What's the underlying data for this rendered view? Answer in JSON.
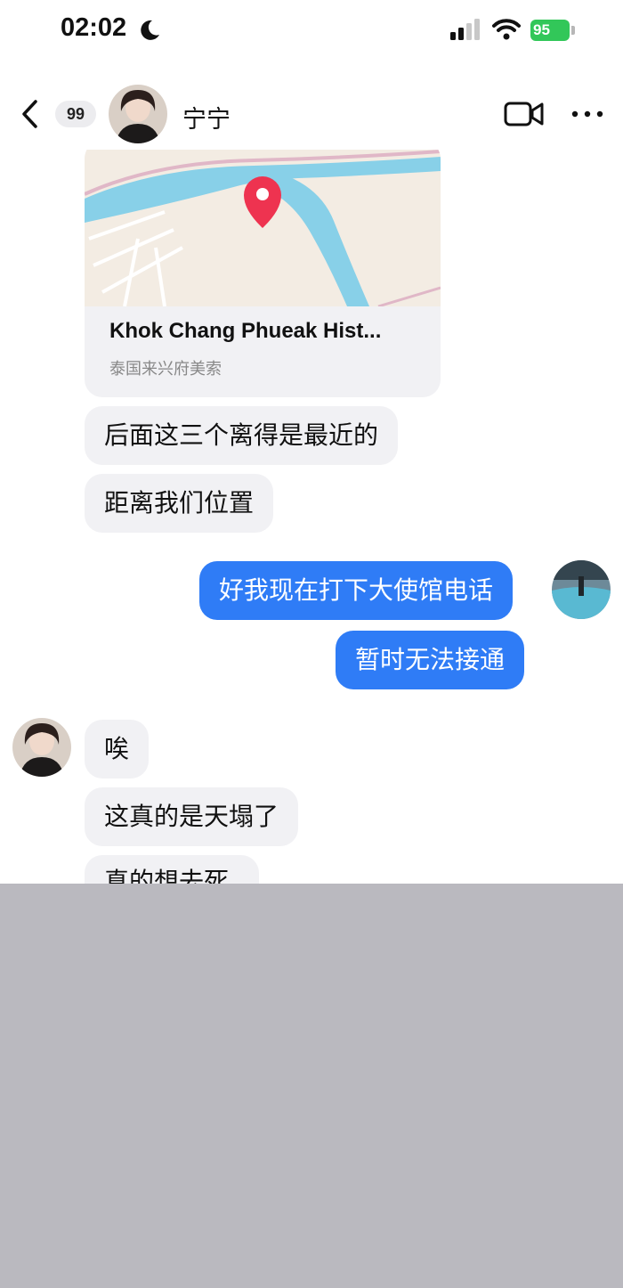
{
  "status_bar": {
    "time": "02:02",
    "battery": "95"
  },
  "header": {
    "unread_count": "99",
    "contact_name": "宁宁"
  },
  "location_card": {
    "title": "Khok Chang Phueak Hist...",
    "subtitle": "泰国来兴府美索"
  },
  "messages": [
    {
      "side": "in",
      "text": "后面这三个离得是最近的"
    },
    {
      "side": "in",
      "text": "距离我们位置"
    },
    {
      "side": "out",
      "text": "好我现在打下大使馆电话"
    },
    {
      "side": "out",
      "text": "暂时无法接通"
    },
    {
      "side": "in",
      "text": "唉"
    },
    {
      "side": "in",
      "text": "这真的是天塌了"
    },
    {
      "side": "in",
      "text": "真的想去死"
    }
  ],
  "colors": {
    "outgoing_bubble": "#2f7cf6",
    "incoming_bubble": "#f1f1f4",
    "battery": "#32c759",
    "map_pin": "#ee3350",
    "river": "#88d0e8",
    "cover": "#bab9bf"
  }
}
